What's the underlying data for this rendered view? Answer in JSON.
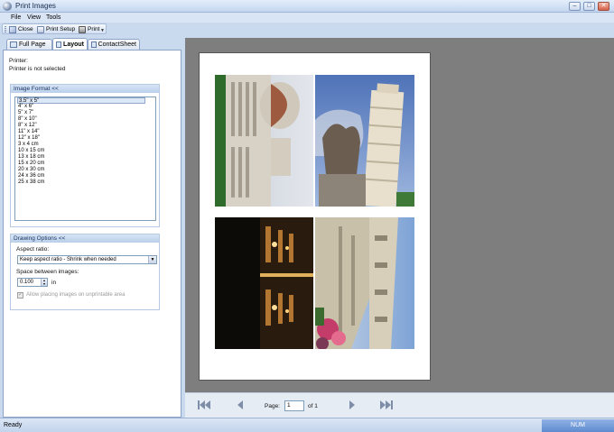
{
  "window": {
    "title": "Print Images"
  },
  "menu": {
    "items": [
      "File",
      "View",
      "Tools"
    ]
  },
  "toolbar": {
    "close_label": "Close",
    "setup_label": "Print Setup",
    "print_label": "Print"
  },
  "tabs": [
    {
      "label": "Full Page"
    },
    {
      "label": "Layout"
    },
    {
      "label": "ContactSheet"
    }
  ],
  "panel": {
    "printer_label": "Printer:",
    "printer_status": "Printer is not selected",
    "image_format_header": "Image Format <<",
    "formats": [
      "3.5\" x 5\"",
      "4\" x 6\"",
      "5\" x 7\"",
      "8\" x 10\"",
      "8\" x 12\"",
      "11\" x 14\"",
      "12\" x 18\"",
      "3 x 4 cm",
      "10 x 15 cm",
      "13 x 18 cm",
      "15 x 20 cm",
      "20 x 30 cm",
      "24 x 36 cm",
      "25 x 38 cm"
    ],
    "selected_format_index": 0,
    "drawing_header": "Drawing Options <<",
    "aspect_label": "Aspect ratio:",
    "aspect_value": "Keep aspect ratio - Shrink when needed",
    "space_label": "Space between images:",
    "space_value": "0.100",
    "space_unit": "in",
    "unprintable_label": "Allow placing images on unprintable area"
  },
  "navigation": {
    "page_label": "Page:",
    "page_value": "1",
    "of_label": "of 1"
  },
  "status": {
    "text": "Ready",
    "num": "NUM"
  },
  "colors": {
    "preview_bg": "#7e7e7e",
    "accent": "#5f8bd0"
  }
}
